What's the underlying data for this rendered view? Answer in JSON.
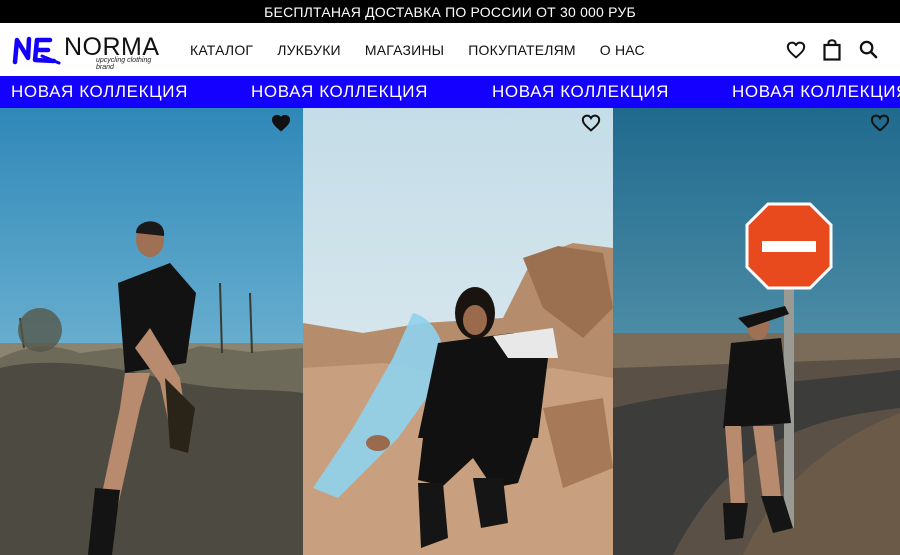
{
  "topbar": {
    "text": "БЕСПЛТАНАЯ ДОСТАВКА ПО РОССИИ ОТ 30 000 РУБ"
  },
  "logo": {
    "word": "NORMA",
    "tagline": "upcycling clothing brand"
  },
  "nav": {
    "items": [
      {
        "label": "КАТАЛОГ"
      },
      {
        "label": "ЛУКБУКИ"
      },
      {
        "label": "МАГАЗИНЫ"
      },
      {
        "label": "ПОКУПАТЕЛЯМ"
      },
      {
        "label": "О НАС"
      }
    ]
  },
  "header_icons": [
    "heart-icon",
    "bag-icon",
    "search-icon"
  ],
  "marquee": {
    "items": [
      "НОВАЯ КОЛЛЕКЦИЯ",
      "НОВАЯ КОЛЛЕКЦИЯ",
      "НОВАЯ КОЛЛЕКЦИЯ",
      "НОВАЯ КОЛЛЕКЦИЯ"
    ],
    "background": "#1400ff"
  },
  "gallery": {
    "cards": [
      {
        "favorite": true
      },
      {
        "favorite": false
      },
      {
        "favorite": false
      }
    ]
  },
  "colors": {
    "accent": "#1400ff",
    "topbar": "#000000"
  }
}
